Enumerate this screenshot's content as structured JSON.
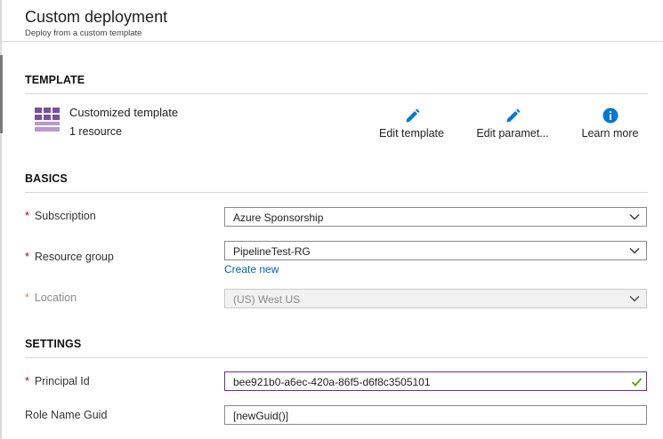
{
  "header": {
    "title": "Custom deployment",
    "subtitle": "Deploy from a custom template"
  },
  "template": {
    "section_title": "TEMPLATE",
    "name": "Customized template",
    "resource_count": "1 resource",
    "icon": "template-grid-icon",
    "actions": [
      {
        "label": "Edit template",
        "icon": "pencil-icon"
      },
      {
        "label": "Edit paramet...",
        "icon": "pencil-icon"
      },
      {
        "label": "Learn more",
        "icon": "info-icon"
      }
    ]
  },
  "basics": {
    "section_title": "BASICS",
    "subscription": {
      "label": "Subscription",
      "value": "Azure Sponsorship"
    },
    "resource_group": {
      "label": "Resource group",
      "value": "PipelineTest-RG",
      "create_new": "Create new"
    },
    "location": {
      "label": "Location",
      "value": "(US) West US"
    }
  },
  "settings": {
    "section_title": "SETTINGS",
    "principal_id": {
      "label": "Principal Id",
      "value": "bee921b0-a6ec-420a-86f5-d6f8c3505101"
    },
    "role_name_guid": {
      "label": "Role Name Guid",
      "value": "[newGuid()]"
    }
  },
  "required_marker": "*",
  "colors": {
    "accent": "#0078d4",
    "required": "#c00000",
    "template_icon": "#7b4f9e",
    "valid": "#57a300",
    "valid_border": "#6b2f8e"
  }
}
